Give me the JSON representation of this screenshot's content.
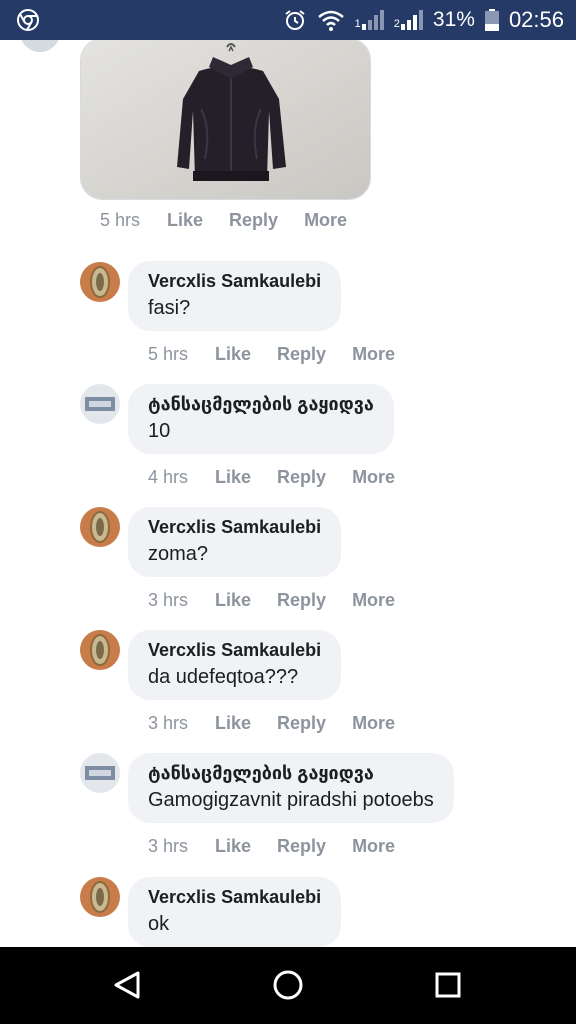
{
  "status_bar": {
    "battery": "31%",
    "time": "02:56",
    "sim1": "1",
    "sim2": "2"
  },
  "post": {
    "time": "5 hrs",
    "like": "Like",
    "reply": "Reply",
    "more": "More"
  },
  "comments": [
    {
      "author": "Vercxlis Samkaulebi",
      "text": "fasi?",
      "time": "5 hrs",
      "like": "Like",
      "reply": "Reply",
      "more": "More"
    },
    {
      "author": "ტანსაცმელების გაყიდვა",
      "text": "10",
      "time": "4 hrs",
      "like": "Like",
      "reply": "Reply",
      "more": "More"
    },
    {
      "author": "Vercxlis Samkaulebi",
      "text": "zoma?",
      "time": "3 hrs",
      "like": "Like",
      "reply": "Reply",
      "more": "More"
    },
    {
      "author": "Vercxlis Samkaulebi",
      "text": "da udefeqtoa???",
      "time": "3 hrs",
      "like": "Like",
      "reply": "Reply",
      "more": "More"
    },
    {
      "author": "ტანსაცმელების გაყიდვა",
      "text": "Gamogigzavnit piradshi potoebs",
      "time": "3 hrs",
      "like": "Like",
      "reply": "Reply",
      "more": "More"
    },
    {
      "author": "Vercxlis Samkaulebi",
      "text": "ok"
    }
  ]
}
